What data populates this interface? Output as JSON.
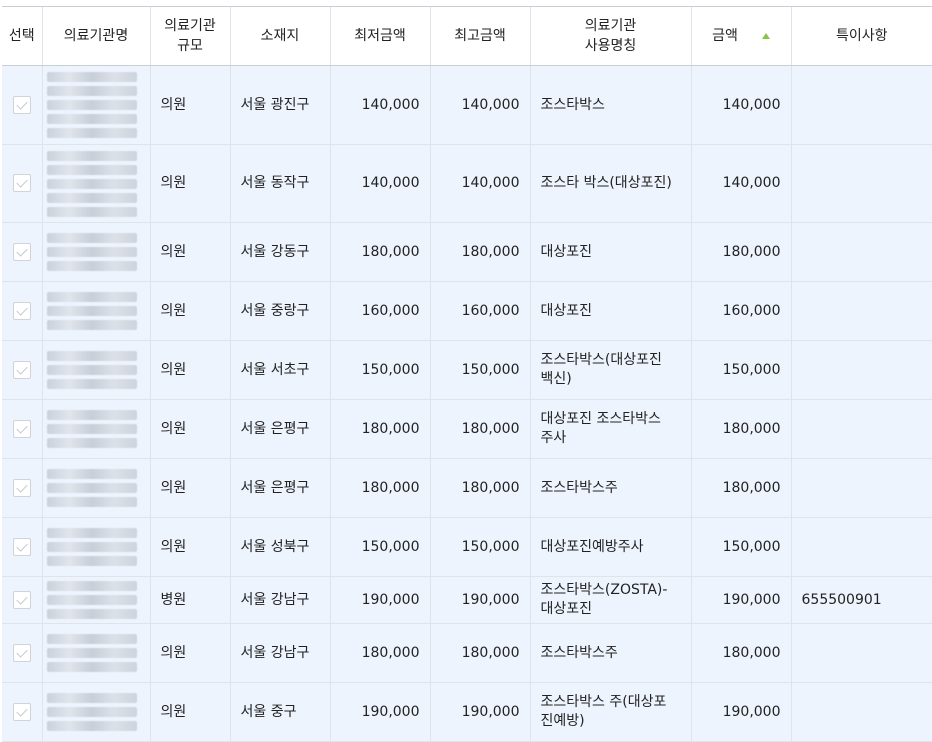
{
  "headers": {
    "select": "선택",
    "org_name": "의료기관명",
    "org_size": "의료기관\n규모",
    "location": "소재지",
    "min_amount": "최저금액",
    "max_amount": "최고금액",
    "usage_name": "의료기관\n사용명칭",
    "amount": "금액",
    "notes": "특이사항"
  },
  "sort": {
    "column": "amount",
    "direction": "ascending",
    "indicator_color": "#8bc34a"
  },
  "colors": {
    "row_bg": "#edf4fe",
    "border": "#dfe3ea"
  },
  "rows": [
    {
      "size": "의원",
      "location": "서울 광진구",
      "min": "140,000",
      "max": "140,000",
      "usage": "조스타박스",
      "amount": "140,000",
      "notes": ""
    },
    {
      "size": "의원",
      "location": "서울 동작구",
      "min": "140,000",
      "max": "140,000",
      "usage": "조스타 박스(대상포진)",
      "amount": "140,000",
      "notes": ""
    },
    {
      "size": "의원",
      "location": "서울 강동구",
      "min": "180,000",
      "max": "180,000",
      "usage": "대상포진",
      "amount": "180,000",
      "notes": ""
    },
    {
      "size": "의원",
      "location": "서울 중랑구",
      "min": "160,000",
      "max": "160,000",
      "usage": "대상포진",
      "amount": "160,000",
      "notes": ""
    },
    {
      "size": "의원",
      "location": "서울 서초구",
      "min": "150,000",
      "max": "150,000",
      "usage": "조스타박스(대상포진\n백신)",
      "amount": "150,000",
      "notes": ""
    },
    {
      "size": "의원",
      "location": "서울 은평구",
      "min": "180,000",
      "max": "180,000",
      "usage": "대상포진 조스타박스\n주사",
      "amount": "180,000",
      "notes": ""
    },
    {
      "size": "의원",
      "location": "서울 은평구",
      "min": "180,000",
      "max": "180,000",
      "usage": "조스타박스주",
      "amount": "180,000",
      "notes": ""
    },
    {
      "size": "의원",
      "location": "서울 성북구",
      "min": "150,000",
      "max": "150,000",
      "usage": "대상포진예방주사",
      "amount": "150,000",
      "notes": ""
    },
    {
      "size": "병원",
      "location": "서울 강남구",
      "min": "190,000",
      "max": "190,000",
      "usage": "조스타박스(ZOSTA)-\n대상포진",
      "amount": "190,000",
      "notes": "655500901"
    },
    {
      "size": "의원",
      "location": "서울 강남구",
      "min": "180,000",
      "max": "180,000",
      "usage": "조스타박스주",
      "amount": "180,000",
      "notes": ""
    },
    {
      "size": "의원",
      "location": "서울 중구",
      "min": "190,000",
      "max": "190,000",
      "usage": "조스타박스 주(대상포\n진예방)",
      "amount": "190,000",
      "notes": ""
    }
  ]
}
